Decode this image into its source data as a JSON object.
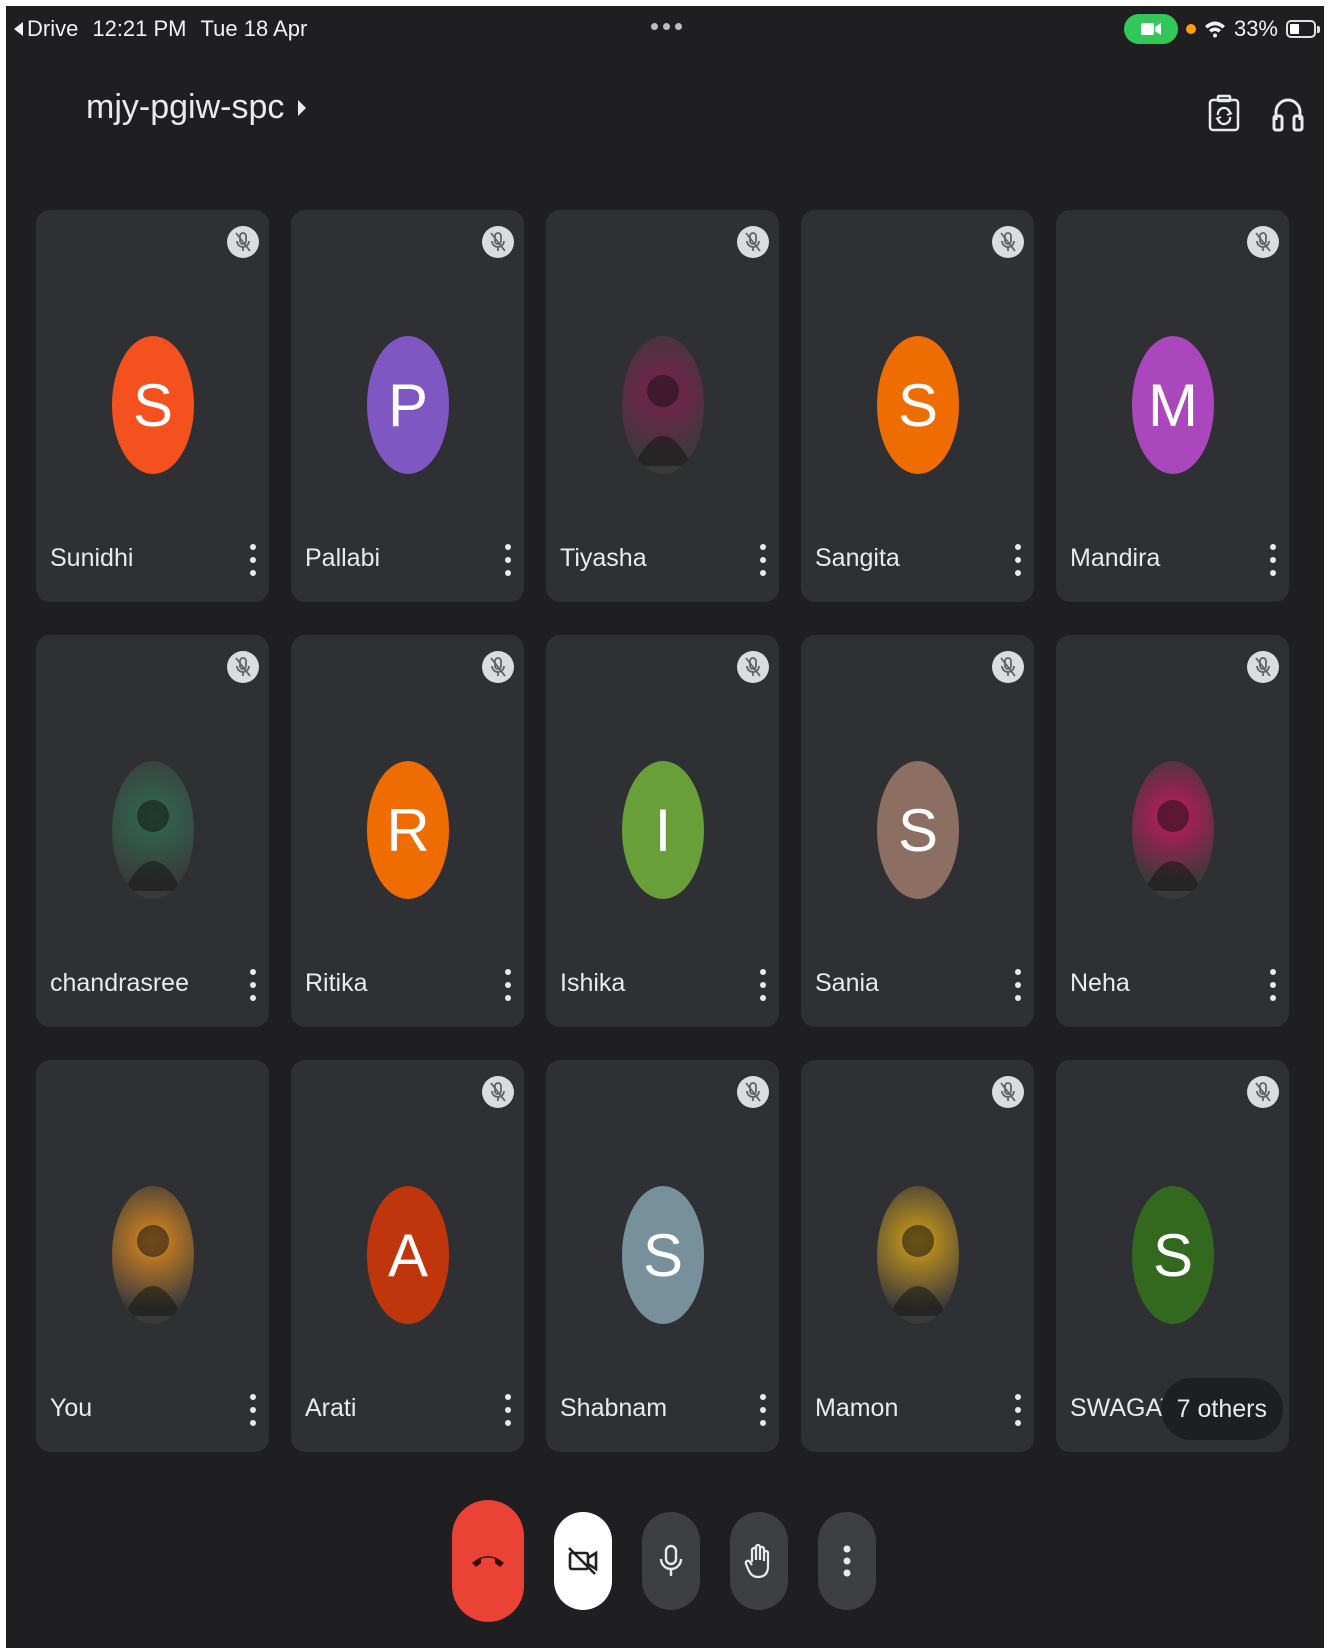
{
  "status_bar": {
    "back_app": "Drive",
    "time": "12:21 PM",
    "date": "Tue 18 Apr",
    "battery": "33%"
  },
  "header": {
    "meeting_code": "mjy-pgiw-spc"
  },
  "participants": [
    {
      "name": "Sunidhi",
      "initial": "S",
      "color": "#f4511e",
      "muted": true
    },
    {
      "name": "Pallabi",
      "initial": "P",
      "color": "#7e57c2",
      "muted": true
    },
    {
      "name": "Tiyasha",
      "initial": "",
      "photo": true,
      "color": "#7b1f4d",
      "muted": true
    },
    {
      "name": "Sangita",
      "initial": "S",
      "color": "#ef6c00",
      "muted": true
    },
    {
      "name": "Mandira",
      "initial": "M",
      "color": "#ab47bc",
      "muted": true
    },
    {
      "name": "chandrasree",
      "initial": "",
      "photo": true,
      "color": "#2f6b52",
      "muted": true
    },
    {
      "name": "Ritika",
      "initial": "R",
      "color": "#ef6c00",
      "muted": true
    },
    {
      "name": "Ishika",
      "initial": "I",
      "color": "#689f38",
      "muted": true
    },
    {
      "name": "Sania",
      "initial": "S",
      "color": "#8d6e63",
      "muted": true
    },
    {
      "name": "Neha",
      "initial": "",
      "photo": true,
      "color": "#c2185b",
      "muted": true
    },
    {
      "name": "You",
      "initial": "",
      "photo": true,
      "color": "#e08a1e",
      "muted": false
    },
    {
      "name": "Arati",
      "initial": "A",
      "color": "#bf360c",
      "muted": true
    },
    {
      "name": "Shabnam",
      "initial": "S",
      "color": "#78909c",
      "muted": true
    },
    {
      "name": "Mamon",
      "initial": "",
      "photo": true,
      "color": "#d4a017",
      "muted": true
    },
    {
      "name": "SWAGATA",
      "initial": "S",
      "color": "#33691e",
      "muted": true,
      "others_label": "7 others"
    }
  ],
  "controls": {
    "end_call": "end-call",
    "video": "video-off",
    "mic": "mic",
    "raise_hand": "raise-hand",
    "more": "more-options"
  }
}
